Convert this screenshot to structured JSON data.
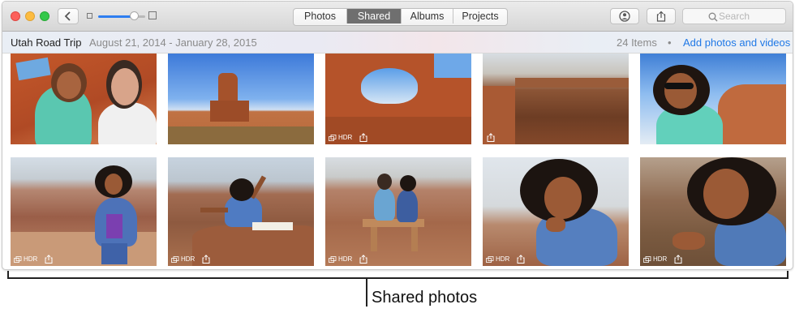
{
  "toolbar": {
    "tabs": [
      "Photos",
      "Shared",
      "Albums",
      "Projects"
    ],
    "active_tab": "Shared",
    "search_placeholder": "Search"
  },
  "album": {
    "title": "Utah Road Trip",
    "dates": "August 21, 2014 - January 28, 2015",
    "item_count": "24 Items",
    "separator": "•",
    "add_link": "Add photos and videos"
  },
  "zoom_slider_level": 0.75,
  "photos": [
    {
      "subject": "selfie-couple",
      "badges": []
    },
    {
      "subject": "red-rock-butte",
      "badges": []
    },
    {
      "subject": "rock-arch",
      "badges": [
        "HDR",
        "share"
      ],
      "hdr_label": "HDR"
    },
    {
      "subject": "canyon-overlook",
      "badges": [
        "share"
      ]
    },
    {
      "subject": "woman-sunglasses",
      "badges": []
    },
    {
      "subject": "woman-canyon-rim",
      "badges": [
        "HDR",
        "share"
      ],
      "hdr_label": "HDR"
    },
    {
      "subject": "woman-arm-raised",
      "badges": [
        "HDR",
        "share"
      ],
      "hdr_label": "HDR"
    },
    {
      "subject": "couple-bench",
      "badges": [
        "HDR",
        "share"
      ],
      "hdr_label": "HDR"
    },
    {
      "subject": "woman-laughing",
      "badges": [
        "HDR",
        "share"
      ],
      "hdr_label": "HDR"
    },
    {
      "subject": "woman-smiling",
      "badges": [
        "HDR",
        "share"
      ],
      "hdr_label": "HDR"
    }
  ],
  "callout": {
    "label": "Shared photos"
  },
  "colors": {
    "accent": "#1f78e6",
    "active_tab": "#6f6f6f"
  }
}
